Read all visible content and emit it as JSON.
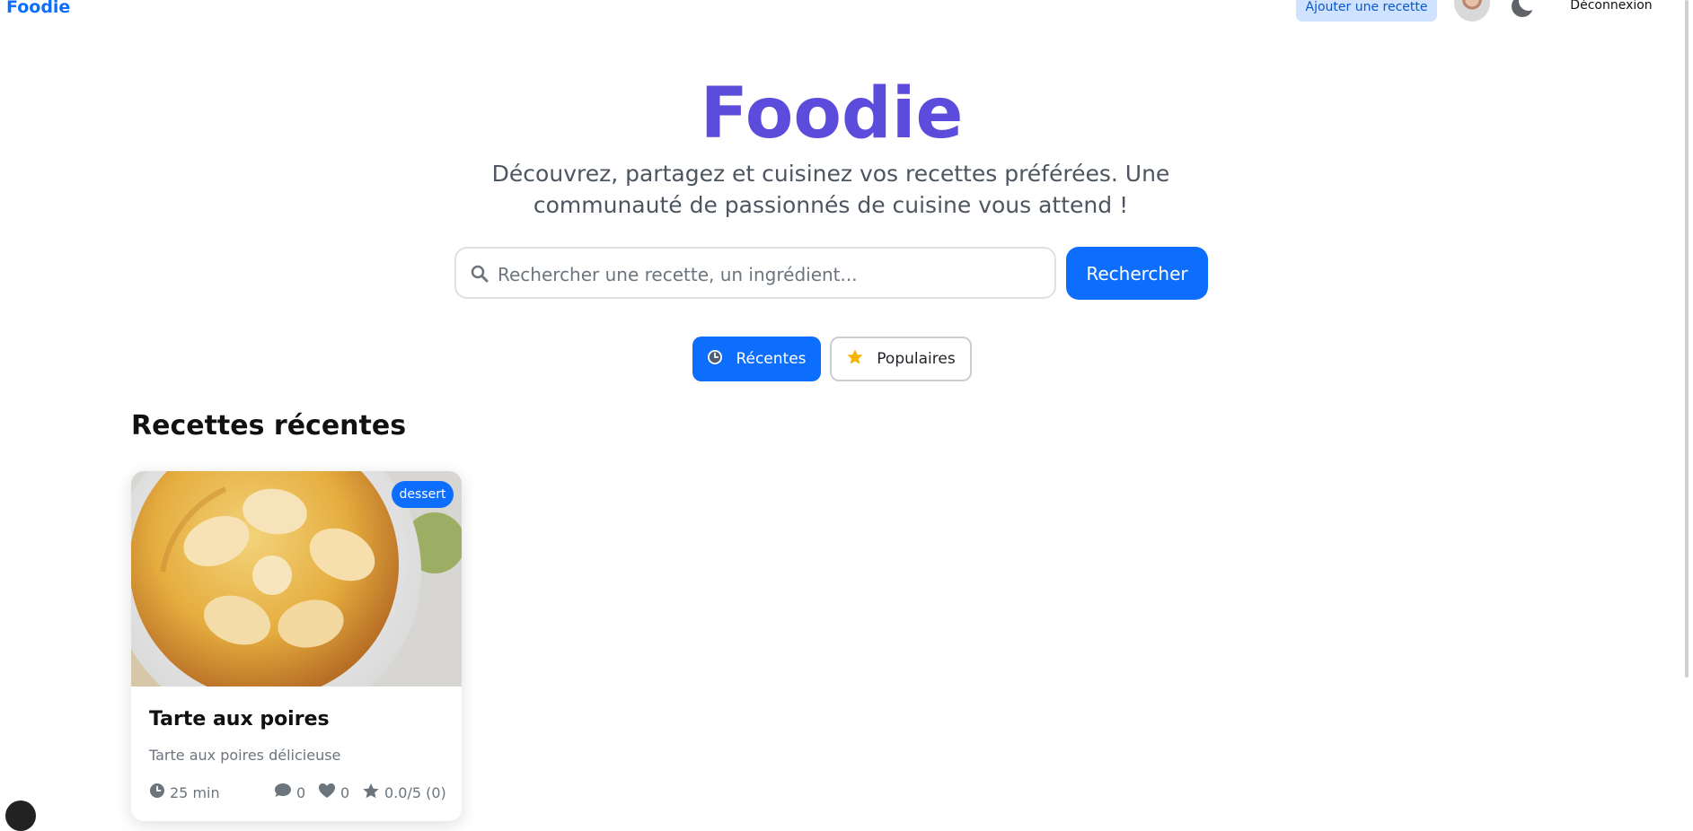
{
  "nav": {
    "brand": "Foodie",
    "add_recipe": "Ajouter une recette",
    "logout": "Déconnexion",
    "avatar_icon": "user-avatar",
    "theme_icon": "moon-icon"
  },
  "hero": {
    "title": "Foodie",
    "subtitle": "Découvrez, partagez et cuisinez vos recettes préférées. Une communauté de passionnés de cuisine vous attend !"
  },
  "search": {
    "placeholder": "Rechercher une recette, un ingrédient...",
    "value": "",
    "button": "Rechercher",
    "icon": "search-icon"
  },
  "filters": [
    {
      "label": "Récentes",
      "icon": "clock-icon",
      "active": true
    },
    {
      "label": "Populaires",
      "icon": "star-icon",
      "active": false
    }
  ],
  "section": {
    "title": "Recettes récentes"
  },
  "recipes": [
    {
      "title": "Tarte aux poires",
      "description": "Tarte aux poires délicieuse",
      "category": "dessert",
      "time": "25 min",
      "comments": "0",
      "likes": "0",
      "rating": "0.0/5 (0)",
      "image": "pear-tart-photo"
    }
  ],
  "colors": {
    "primary": "#0d6efd",
    "hero_title": "#5b4cdb",
    "add_button_bg": "#cfe2ff"
  }
}
